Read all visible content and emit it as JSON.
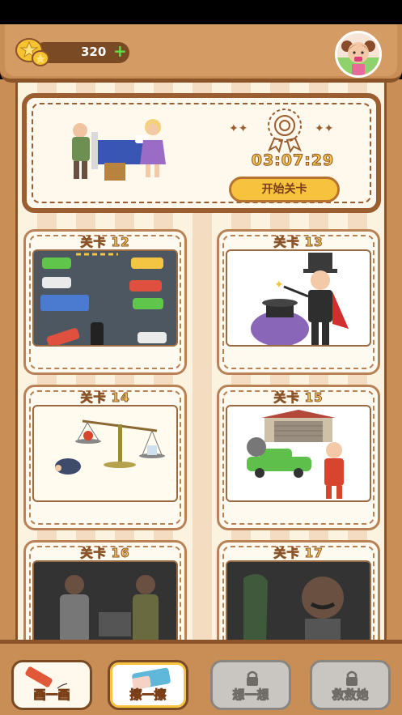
{
  "header": {
    "coins": "320",
    "add": "+"
  },
  "banner": {
    "timer": "03:07:29",
    "start_label": "开始关卡"
  },
  "levels": [
    {
      "title": "关卡 12",
      "state": "unlocked"
    },
    {
      "title": "关卡 13",
      "state": "unlocked"
    },
    {
      "title": "关卡 14",
      "state": "unlocked"
    },
    {
      "title": "关卡 15",
      "state": "unlocked"
    },
    {
      "title": "关卡 16",
      "state": "locked"
    },
    {
      "title": "关卡 17",
      "state": "locked"
    }
  ],
  "tools": [
    {
      "label": "画一画",
      "state": "available"
    },
    {
      "label": "擦一擦",
      "state": "selected"
    },
    {
      "label": "想一想",
      "state": "locked"
    },
    {
      "label": "救救她",
      "state": "locked"
    }
  ],
  "colors": {
    "wood": "#c98d56",
    "wood_dark": "#8a5328",
    "gold": "#f7c33e",
    "cream": "#fff8ec"
  }
}
